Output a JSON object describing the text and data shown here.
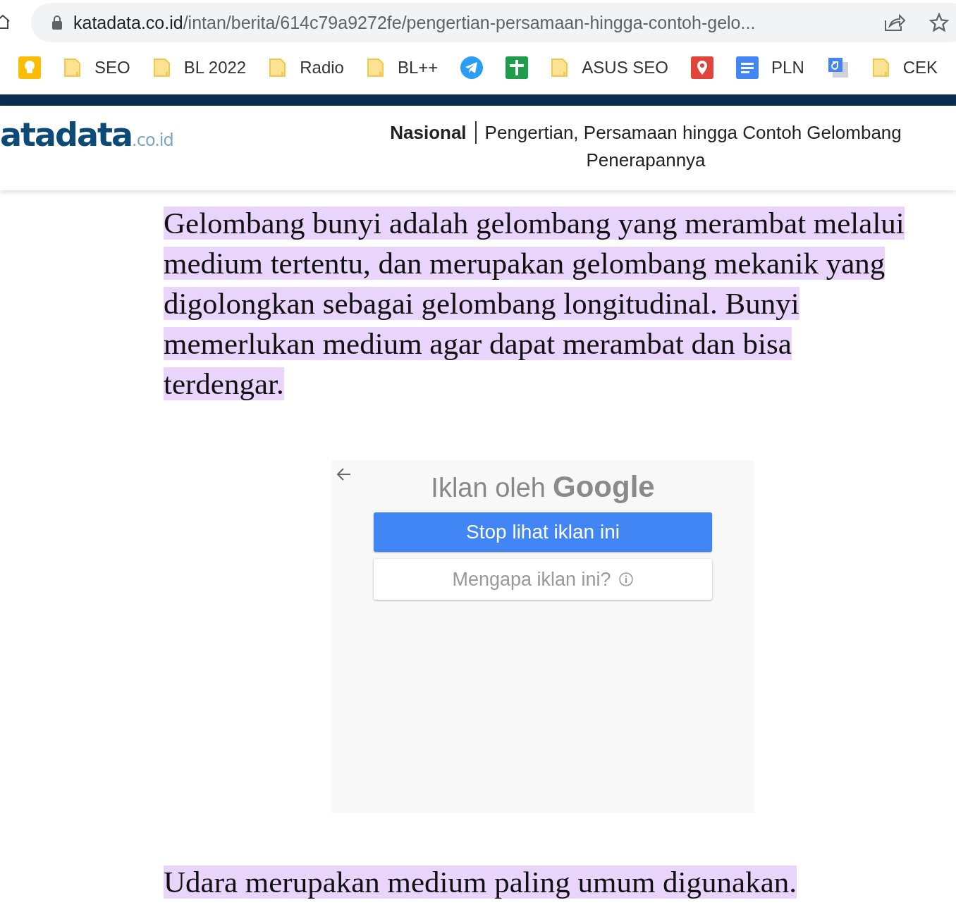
{
  "address_bar": {
    "domain": "katadata.co.id",
    "path": "/intan/berita/614c79a9272fe/pengertian-persamaan-hingga-contoh-gelo..."
  },
  "bookmarks": [
    {
      "kind": "keep"
    },
    {
      "kind": "folder",
      "label": "SEO"
    },
    {
      "kind": "folder",
      "label": "BL 2022"
    },
    {
      "kind": "folder",
      "label": "Radio"
    },
    {
      "kind": "folder",
      "label": "BL++"
    },
    {
      "kind": "telegram"
    },
    {
      "kind": "sheets"
    },
    {
      "kind": "folder",
      "label": "ASUS SEO"
    },
    {
      "kind": "maps"
    },
    {
      "kind": "docs",
      "label": "PLN"
    },
    {
      "kind": "translate"
    },
    {
      "kind": "folder",
      "label": "CEK"
    }
  ],
  "site_header": {
    "logo": "atadata",
    "logo_suffix": ".co.id",
    "section": "Nasional",
    "title_line_1": "Pengertian, Persamaan hingga Contoh Gelombang",
    "title_line_2": "Penerapannya"
  },
  "article": {
    "paragraph_1": "Gelombang bunyi adalah gelombang yang merambat melalui medium tertentu, dan merupakan gelombang mekanik yang digolongkan sebagai gelombang longitudinal. Bunyi memerlukan medium agar dapat merambat dan bisa terdengar.",
    "paragraph_2": "Udara merupakan medium paling umum digunakan."
  },
  "ad": {
    "heading": "Iklan oleh",
    "brand": "Google",
    "primary_button": "Stop lihat iklan ini",
    "secondary_button": "Mengapa iklan ini?"
  }
}
